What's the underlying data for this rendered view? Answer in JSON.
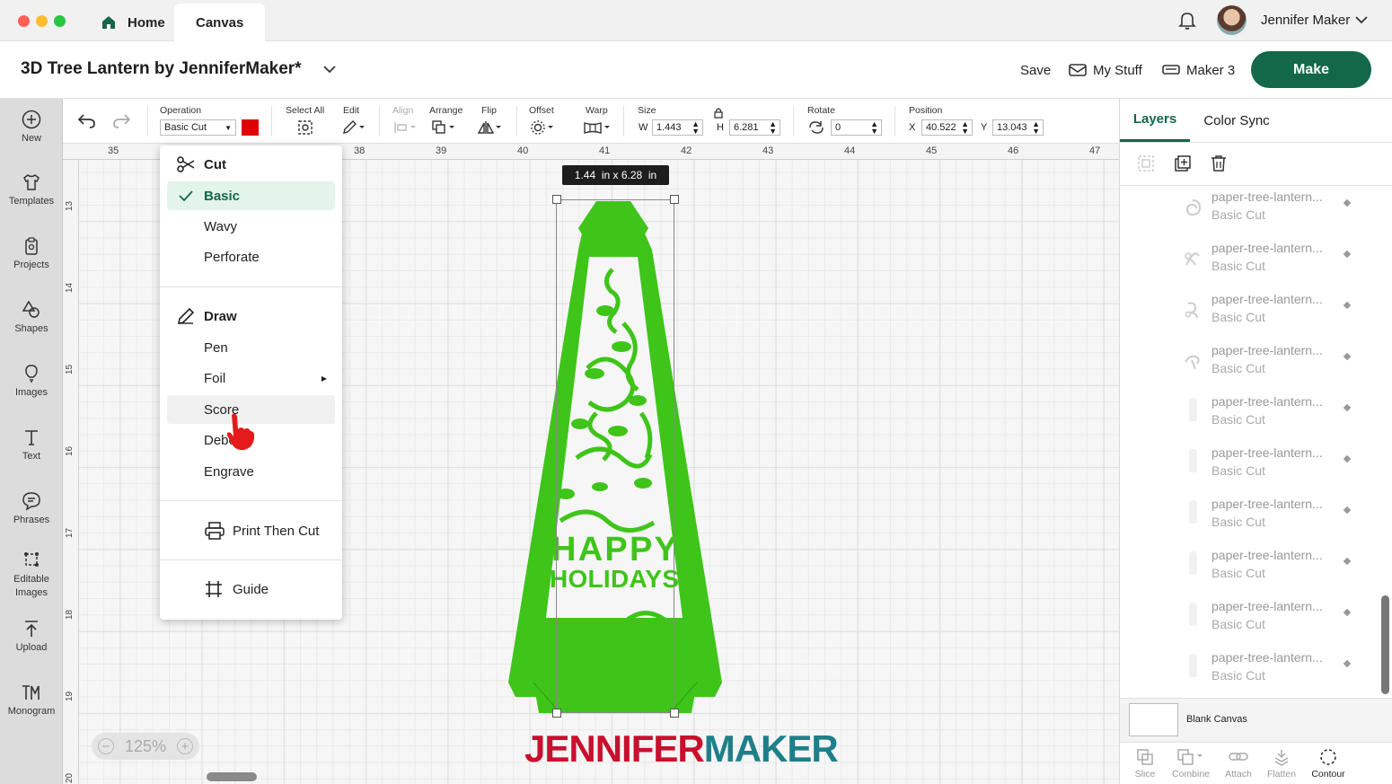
{
  "tabs": {
    "home": "Home",
    "canvas": "Canvas"
  },
  "user": {
    "name": "Jennifer Maker"
  },
  "project": {
    "title": "3D Tree Lantern by JenniferMaker*"
  },
  "header": {
    "save": "Save",
    "my_stuff": "My Stuff",
    "machine": "Maker 3",
    "make": "Make"
  },
  "sidebar": {
    "items": [
      "New",
      "Templates",
      "Projects",
      "Shapes",
      "Images",
      "Text",
      "Phrases",
      "Editable Images",
      "Upload",
      "Monogram"
    ]
  },
  "toolbar": {
    "operation_label": "Operation",
    "operation_value": "Basic Cut",
    "operation_color": "#e00000",
    "select_all": "Select All",
    "edit": "Edit",
    "align": "Align",
    "arrange": "Arrange",
    "flip": "Flip",
    "offset": "Offset",
    "warp": "Warp",
    "size": "Size",
    "w_label": "W",
    "w_value": "1.443",
    "h_label": "H",
    "h_value": "6.281",
    "rotate": "Rotate",
    "rotate_value": "0",
    "position": "Position",
    "x_label": "X",
    "x_value": "40.522",
    "y_label": "Y",
    "y_value": "13.043"
  },
  "ruler": {
    "top": [
      "35",
      "38",
      "39",
      "40",
      "41",
      "42",
      "43",
      "44",
      "45",
      "46",
      "47"
    ],
    "left": [
      "13",
      "14",
      "15",
      "16",
      "17",
      "18",
      "19",
      "20"
    ]
  },
  "selection": {
    "size_tooltip": "1.44  in x 6.28  in"
  },
  "design": {
    "line1": "HAPPY",
    "line2": "HOLIDAYS",
    "color": "#3fc41a"
  },
  "zoom": {
    "value": "125%"
  },
  "watermark": {
    "part1": "JENNIFER",
    "part2": "MAKER"
  },
  "operation_menu": {
    "cut_header": "Cut",
    "cut_items": [
      "Basic",
      "Wavy",
      "Perforate"
    ],
    "selected": "Basic",
    "draw_header": "Draw",
    "draw_items": [
      "Pen",
      "Foil",
      "Score",
      "Deboss",
      "Engrave"
    ],
    "hovered": "Score",
    "print_then_cut": "Print Then Cut",
    "guide": "Guide"
  },
  "panel": {
    "tabs": [
      "Layers",
      "Color Sync"
    ],
    "layers": [
      {
        "name": "paper-tree-lantern...",
        "op": "Basic Cut"
      },
      {
        "name": "paper-tree-lantern...",
        "op": "Basic Cut"
      },
      {
        "name": "paper-tree-lantern...",
        "op": "Basic Cut"
      },
      {
        "name": "paper-tree-lantern...",
        "op": "Basic Cut"
      },
      {
        "name": "paper-tree-lantern...",
        "op": "Basic Cut"
      },
      {
        "name": "paper-tree-lantern...",
        "op": "Basic Cut"
      },
      {
        "name": "paper-tree-lantern...",
        "op": "Basic Cut"
      },
      {
        "name": "paper-tree-lantern...",
        "op": "Basic Cut"
      },
      {
        "name": "paper-tree-lantern...",
        "op": "Basic Cut"
      },
      {
        "name": "paper-tree-lantern...",
        "op": "Basic Cut"
      }
    ],
    "blank_canvas": "Blank Canvas",
    "bottom": [
      "Slice",
      "Combine",
      "Attach",
      "Flatten",
      "Contour"
    ]
  },
  "colors": {
    "accent": "#126848",
    "design_green": "#3fc41a",
    "brand_red": "#c8102e",
    "brand_teal": "#1e7f8a"
  }
}
